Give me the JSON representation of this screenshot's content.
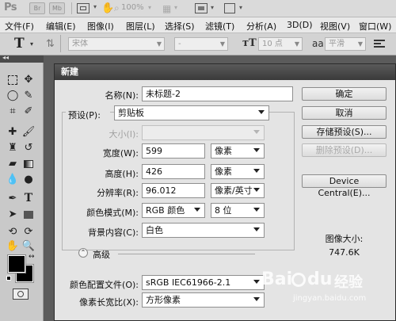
{
  "app": {
    "logo": "Ps",
    "buttons": [
      "Br",
      "Mb"
    ],
    "zoom": "100%"
  },
  "menubar": {
    "items": [
      "文件(F)",
      "编辑(E)",
      "图像(I)",
      "图层(L)",
      "选择(S)",
      "滤镜(T)",
      "分析(A)",
      "3D(D)",
      "视图(V)",
      "窗口(W)"
    ]
  },
  "options_bar": {
    "tool_glyph": "T",
    "font_family": "宋体",
    "font_style": "-",
    "font_size": "10 点",
    "aa_icon": "aa",
    "antialias": "平滑"
  },
  "dialog": {
    "title": "新建",
    "name_label": "名称(N):",
    "name_value": "未标题-2",
    "preset_label": "预设(P):",
    "preset_value": "剪贴板",
    "size_label": "大小(I):",
    "width_label": "宽度(W):",
    "width_value": "599",
    "width_unit": "像素",
    "height_label": "高度(H):",
    "height_value": "426",
    "height_unit": "像素",
    "resolution_label": "分辨率(R):",
    "resolution_value": "96.012",
    "resolution_unit": "像素/英寸",
    "color_mode_label": "颜色模式(M):",
    "color_mode_value": "RGB 颜色",
    "bit_depth": "8 位",
    "bg_label": "背景内容(C):",
    "bg_value": "白色",
    "advanced_label": "高级",
    "profile_label": "颜色配置文件(O):",
    "profile_value": "sRGB IEC61966-2.1",
    "pixel_aspect_label": "像素长宽比(X):",
    "pixel_aspect_value": "方形像素",
    "buttons": {
      "ok": "确定",
      "cancel": "取消",
      "save_preset": "存储预设(S)...",
      "delete_preset": "删除预设(D)...",
      "device_central": "Device Central(E)..."
    },
    "image_size_label": "图像大小:",
    "image_size_value": "747.6K"
  },
  "watermark": {
    "brand": "Bai",
    "brand2": "du",
    "suffix": "经验",
    "url": "jingyan.baidu.com"
  }
}
